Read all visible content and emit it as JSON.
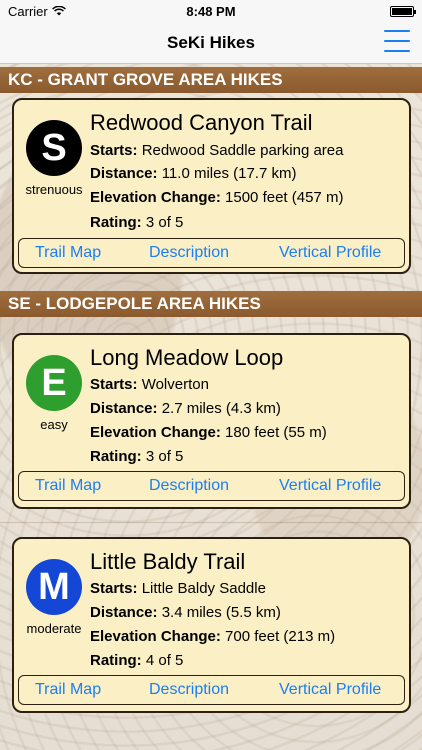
{
  "status": {
    "carrier": "Carrier",
    "time": "8:48 PM"
  },
  "nav": {
    "title": "SeKi Hikes",
    "menu_icon": "hamburger-menu-icon"
  },
  "sections": [
    {
      "title": "KC - GRANT GROVE AREA HIKES"
    },
    {
      "title": "SE - LODGEPOLE AREA HIKES"
    }
  ],
  "labels": {
    "starts": "Starts:",
    "distance": "Distance:",
    "elevation": "Elevation Change:",
    "rating": "Rating:"
  },
  "links": {
    "trail_map": "Trail Map",
    "description": "Description",
    "vertical_profile": "Vertical Profile"
  },
  "hikes": [
    {
      "badge_letter": "S",
      "badge_color": "#000000",
      "difficulty": "strenuous",
      "name": "Redwood Canyon Trail",
      "starts": "Redwood Saddle parking area",
      "distance": "11.0 miles (17.7 km)",
      "elevation": "1500 feet (457 m)",
      "rating": "3 of 5"
    },
    {
      "badge_letter": "E",
      "badge_color": "#2e9e2e",
      "difficulty": "easy",
      "name": "Long Meadow Loop",
      "starts": "Wolverton",
      "distance": "2.7 miles (4.3 km)",
      "elevation": "180 feet (55 m)",
      "rating": "3 of 5"
    },
    {
      "badge_letter": "M",
      "badge_color": "#1547d6",
      "difficulty": "moderate",
      "name": "Little Baldy Trail",
      "starts": "Little Baldy Saddle",
      "distance": "3.4 miles (5.5 km)",
      "elevation": "700 feet (213 m)",
      "rating": "4 of 5"
    }
  ]
}
